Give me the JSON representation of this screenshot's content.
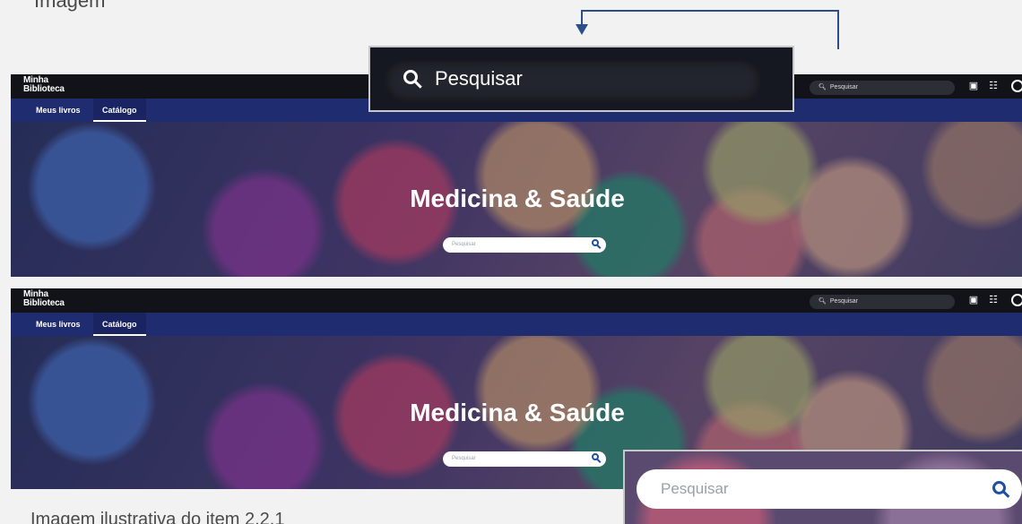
{
  "top_text": "Imagem",
  "screenshots": [
    {
      "logo_line1": "Minha",
      "logo_line2": "Biblioteca",
      "top_search_placeholder": "Pesquisar",
      "tabs": [
        "Meus livros",
        "Catálogo"
      ],
      "hero_title": "Medicina & Saúde",
      "hero_search_placeholder": "Pesquisar"
    },
    {
      "logo_line1": "Minha",
      "logo_line2": "Biblioteca",
      "top_search_placeholder": "Pesquisar",
      "tabs": [
        "Meus livros",
        "Catálogo"
      ],
      "hero_title": "Medicina & Saúde",
      "hero_search_placeholder": "Pesquisar"
    }
  ],
  "zoom_top_text": "Pesquisar",
  "zoom_bottom_text": "Pesquisar",
  "caption": "Imagem ilustrativa do item 2.2.1",
  "colors": {
    "accent": "#202c70",
    "topbar": "#111318",
    "connector": "#2a4f8b"
  },
  "icons": [
    "search-icon",
    "reader-icon",
    "apps-icon",
    "user-icon"
  ]
}
